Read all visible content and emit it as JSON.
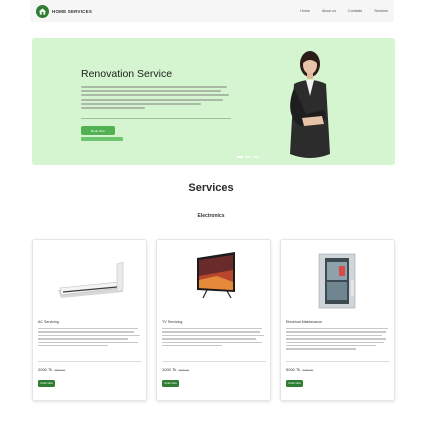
{
  "brand": {
    "name": "HOME SERVICES",
    "logo_icon": "wrench-house-icon"
  },
  "nav": {
    "links": [
      "Home",
      "About us",
      "Contacts",
      "Services"
    ]
  },
  "hero": {
    "title": "Renovation Service",
    "button_label": "Book Now",
    "accent_color": "#d4f5cf"
  },
  "services": {
    "title": "Services",
    "category": "Electronics",
    "cards": [
      {
        "title": "AC Servicing",
        "price": "2000 Tk",
        "old_price": "2500 Tk",
        "button_label": "Order Now",
        "image_icon": "air-conditioner-icon"
      },
      {
        "title": "TV Servicing",
        "price": "1000 Tk",
        "old_price": "1500 Tk",
        "button_label": "Order Now",
        "image_icon": "television-icon"
      },
      {
        "title": "Electrical Maintenance",
        "price": "5000 Tk",
        "old_price": "7000 Tk",
        "button_label": "Order Now",
        "image_icon": "fridge-icon"
      }
    ]
  }
}
